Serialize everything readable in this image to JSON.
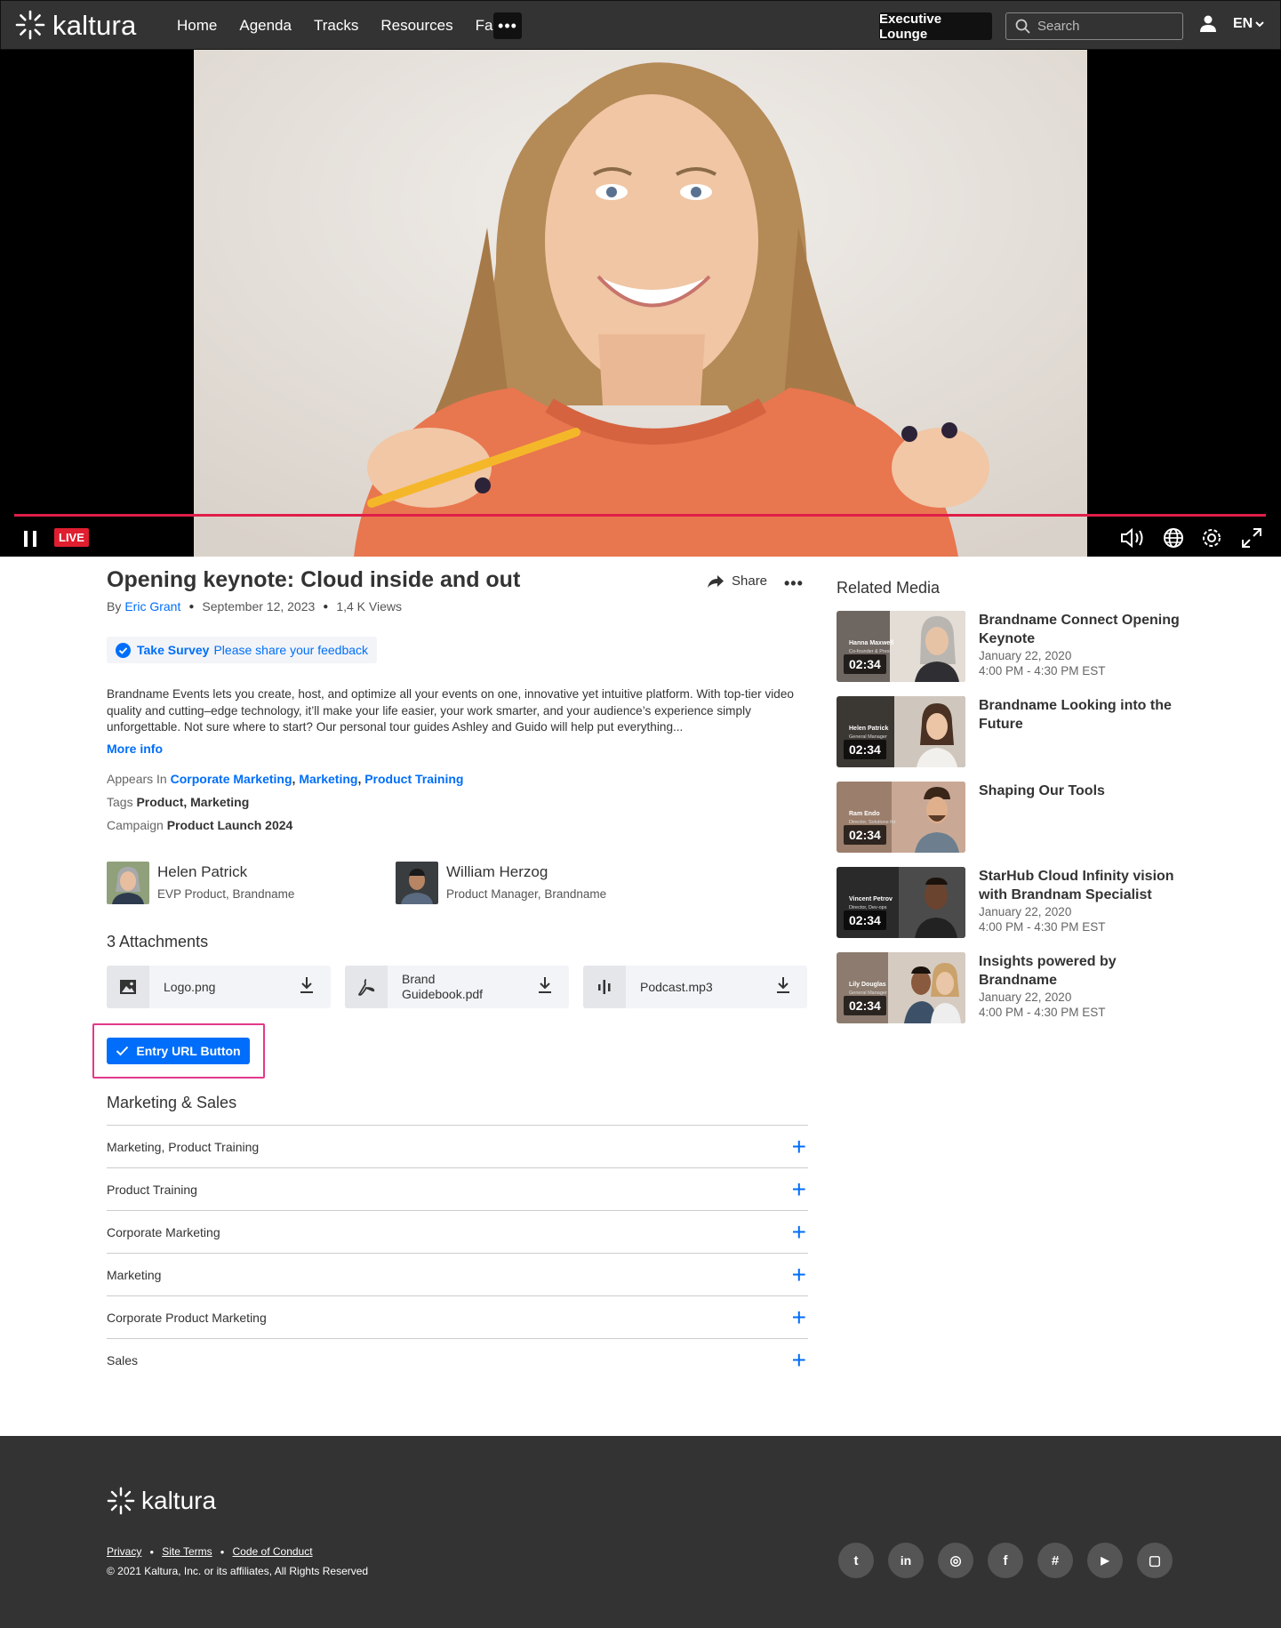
{
  "header": {
    "brand": "kaltura",
    "nav": [
      "Home",
      "Agenda",
      "Tracks",
      "Resources",
      "Faq"
    ],
    "more_label": "•••",
    "lounge_label": "Executive Lounge",
    "search_placeholder": "Search",
    "lang": "EN"
  },
  "player": {
    "live_label": "LIVE",
    "progress": 1.0
  },
  "entry": {
    "title": "Opening keynote: Cloud inside and out",
    "share_label": "Share",
    "more_label": "•••",
    "by_prefix": "By",
    "author": "Eric Grant",
    "date": "September 12, 2023",
    "views": "1,4 K Views",
    "survey_title": "Take Survey",
    "survey_sub": "Please share your feedback",
    "description": "Brandname Events lets you create, host, and optimize all your events on one, innovative yet intuitive platform. With top-tier video quality and cutting–edge technology, it’ll make your life easier, your work smarter, and your audience’s experience simply unforgettable. Not sure where to start? Our personal tour guides Ashley and Guido will help put everything...",
    "more_info": "More info",
    "appears_in_label": "Appears In",
    "appears_in": [
      "Corporate Marketing",
      "Marketing",
      "Product Training"
    ],
    "tags_label": "Tags",
    "tags": "Product, Marketing",
    "campaign_label": "Campaign",
    "campaign": "Product Launch 2024"
  },
  "presenters": [
    {
      "name": "Helen Patrick",
      "role": "EVP Product, Brandname"
    },
    {
      "name": "William Herzog",
      "role": "Product Manager, Brandname"
    }
  ],
  "attachments": {
    "heading": "3 Attachments",
    "items": [
      {
        "name": "Logo.png",
        "icon": "image-icon"
      },
      {
        "name": "Brand Guidebook.pdf",
        "icon": "pdf-icon"
      },
      {
        "name": "Podcast.mp3",
        "icon": "audio-icon"
      }
    ]
  },
  "entry_url_button": "Entry URL Button",
  "categories": {
    "heading": "Marketing & Sales",
    "items": [
      "Marketing, Product Training",
      "Product Training",
      "Corporate Marketing",
      "Marketing",
      "Corporate Product Marketing",
      "Sales"
    ]
  },
  "related": {
    "heading": "Related Media",
    "items": [
      {
        "title": "Brandname Connect Opening Keynote",
        "date": "January 22, 2020",
        "time": "4:00 PM - 4:30 PM EST",
        "duration": "02:34",
        "thumb_name": "Hanna Maxwell",
        "thumb_role": "Co-founder & President"
      },
      {
        "title": "Brandname Looking into the Future",
        "date": "",
        "time": "",
        "duration": "02:34",
        "thumb_name": "Helen Patrick",
        "thumb_role": "General Manager"
      },
      {
        "title": "Shaping Our Tools",
        "date": "",
        "time": "",
        "duration": "02:34",
        "thumb_name": "Ram Endo",
        "thumb_role": "Director, Solutions for"
      },
      {
        "title": "StarHub Cloud Infinity vision with Brandnam Specialist",
        "date": "January 22, 2020",
        "time": "4:00 PM - 4:30 PM EST",
        "duration": "02:34",
        "thumb_name": "Vincent Petrov",
        "thumb_role": "Director, Dev-ops"
      },
      {
        "title": "Insights powered by Brandname",
        "date": "January 22, 2020",
        "time": "4:00 PM - 4:30 PM EST",
        "duration": "02:34",
        "thumb_name": "Lily Douglas",
        "thumb_role": "General Manager"
      }
    ]
  },
  "footer": {
    "brand": "kaltura",
    "links": [
      "Privacy",
      "Site Terms",
      "Code of Conduct"
    ],
    "copyright": "© 2021 Kaltura, Inc. or its affiliates, All Rights Reserved",
    "social": [
      {
        "icon": "twitter-icon",
        "glyph": "t"
      },
      {
        "icon": "linkedin-icon",
        "glyph": "in"
      },
      {
        "icon": "instagram-icon",
        "glyph": "◎"
      },
      {
        "icon": "facebook-icon",
        "glyph": "f"
      },
      {
        "icon": "slack-icon",
        "glyph": "#"
      },
      {
        "icon": "youtube-icon",
        "glyph": "▶"
      },
      {
        "icon": "twitch-icon",
        "glyph": "▢"
      }
    ]
  },
  "colors": {
    "accent": "#006efa",
    "live": "#e01e2f",
    "highlight": "#e2398a",
    "header_bg": "#333333"
  }
}
